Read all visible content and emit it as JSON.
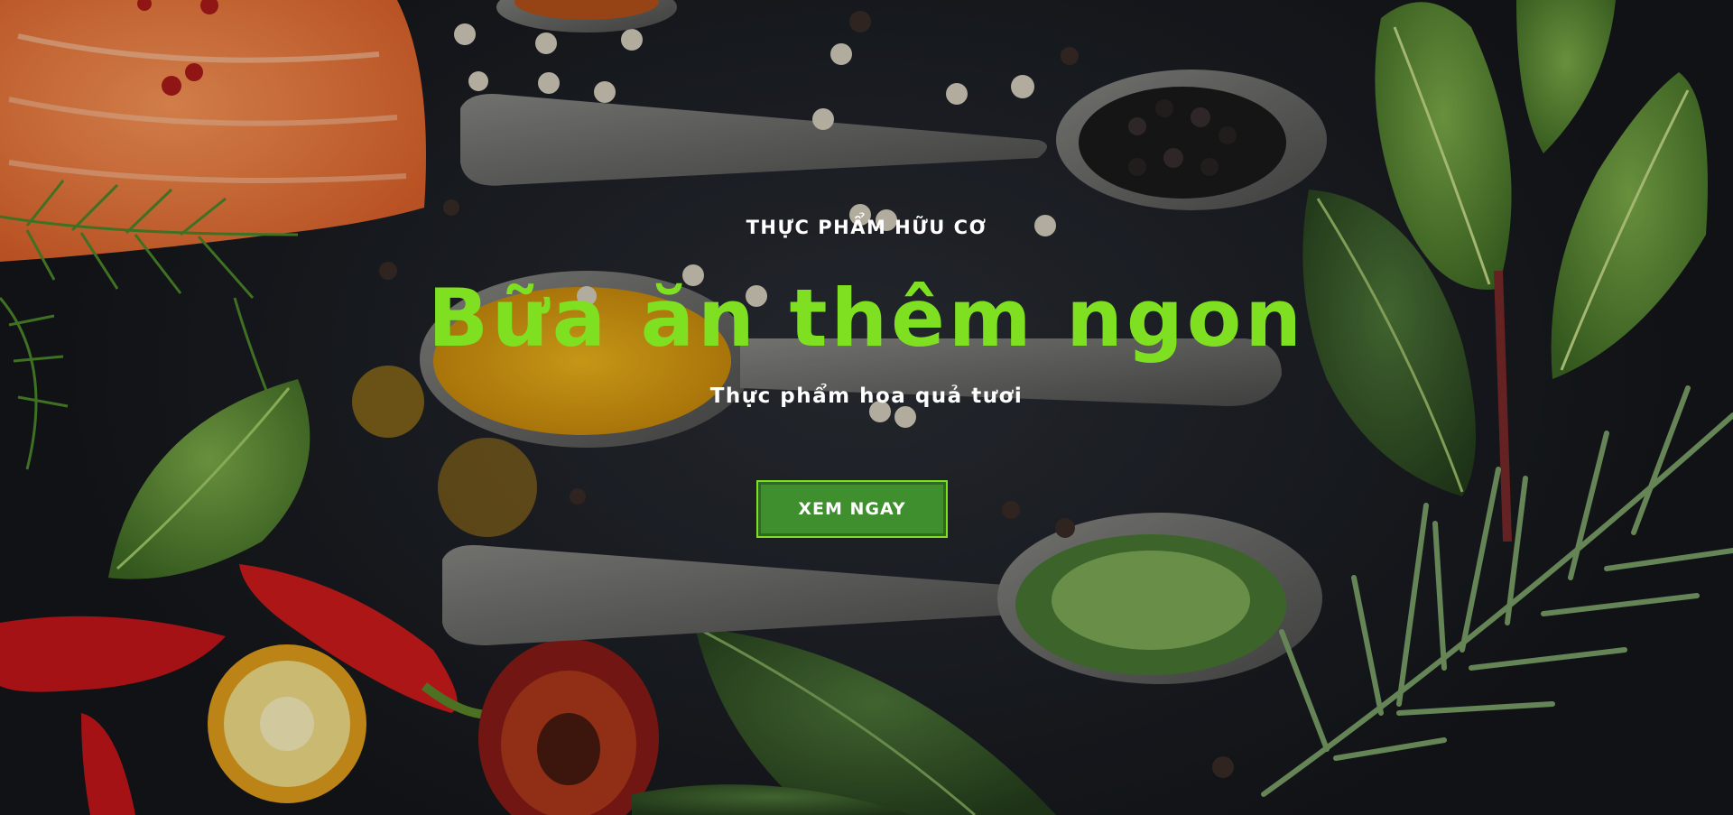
{
  "hero": {
    "eyebrow": "THỰC PHẨM HỮU CƠ",
    "headline": "Bữa ăn thêm ngon",
    "subline": "Thực phẩm hoa quả tươi",
    "cta_label": "XEM NGAY"
  },
  "colors": {
    "accent": "#7fe021",
    "button_bg": "#3f8f2e",
    "text": "#ffffff",
    "background": "#1e2127"
  }
}
